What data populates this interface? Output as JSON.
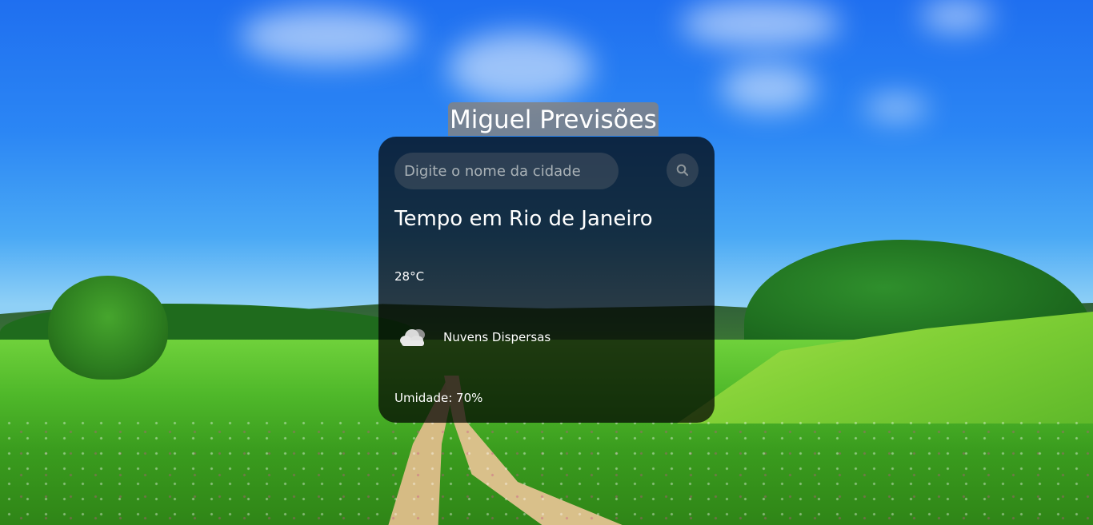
{
  "app": {
    "title": "Miguel Previsões"
  },
  "search": {
    "placeholder": "Digite o nome da cidade",
    "value": "",
    "button_icon": "search-icon"
  },
  "weather": {
    "city_heading": "Tempo em Rio de Janeiro",
    "temperature": "28°C",
    "condition_icon": "cloud-icon",
    "condition": "Nuvens Dispersas",
    "humidity": "Umidade: 70%"
  },
  "colors": {
    "card_background": "#000000",
    "text": "#ffffff",
    "title_background": "#828282"
  }
}
